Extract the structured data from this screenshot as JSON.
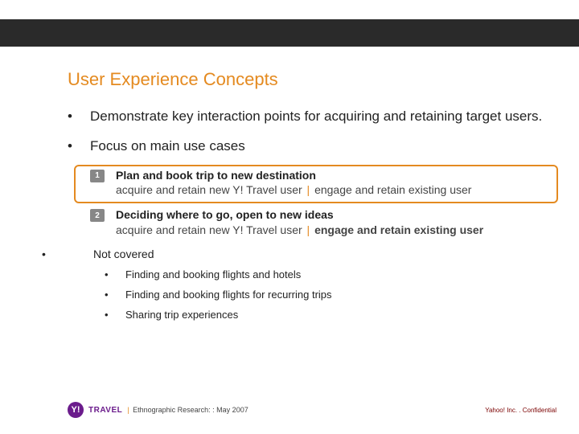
{
  "title": "User Experience Concepts",
  "bullets": {
    "b1": "Demonstrate key interaction points for acquiring and retaining target users.",
    "b2": "Focus on main use cases"
  },
  "cases": [
    {
      "num": "1",
      "title": "Plan and book trip to new destination",
      "sub_a": "acquire and retain new Y! Travel user",
      "sub_b": "engage and retain existing user"
    },
    {
      "num": "2",
      "title": "Deciding where to go, open to new ideas",
      "sub_a": "acquire and retain new Y! Travel user",
      "sub_b": "engage and retain existing user"
    }
  ],
  "not_covered": {
    "heading": "Not covered",
    "items": [
      "Finding and booking flights and hotels",
      "Finding and booking flights for recurring trips",
      "Sharing trip experiences"
    ]
  },
  "footer": {
    "logo_y": "Y!",
    "logo_travel": "TRAVEL",
    "caption": "Ethnographic Research: : May 2007",
    "confidential": "Yahoo! Inc. . Confidential"
  }
}
